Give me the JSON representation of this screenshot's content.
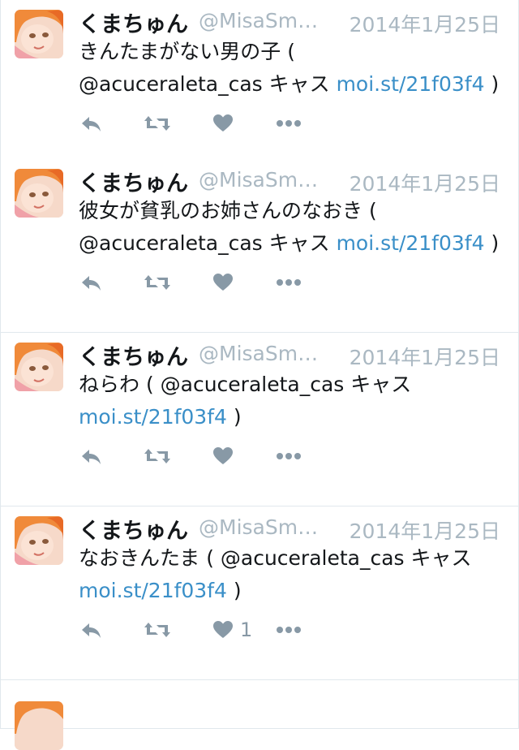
{
  "tweets": [
    {
      "display_name": "くまちゅん",
      "handle": "@MisaSm…",
      "date": "2014年1月25日",
      "text_parts": [
        "きんたまがない男の子 (",
        "@acuceraleta_cas キャス ",
        "moi.st/21f03f4",
        " )"
      ],
      "likes": ""
    },
    {
      "display_name": "くまちゅん",
      "handle": "@MisaSm…",
      "date": "2014年1月25日",
      "text_parts": [
        "彼女が貧乳のお姉さんのなおき (",
        "@acuceraleta_cas キャス ",
        "moi.st/21f03f4",
        " )"
      ],
      "likes": ""
    },
    {
      "display_name": "くまちゅん",
      "handle": "@MisaSm…",
      "date": "2014年1月25日",
      "text_parts": [
        "ねらわ ( @acuceraleta_cas キャス",
        "",
        "moi.st/21f03f4",
        " )"
      ],
      "likes": ""
    },
    {
      "display_name": "くまちゅん",
      "handle": "@MisaSm…",
      "date": "2014年1月25日",
      "text_parts": [
        "なおきんたま ( @acuceraleta_cas キャス",
        "",
        "moi.st/21f03f4",
        " )"
      ],
      "likes": "1"
    }
  ],
  "icons": {
    "reply": "reply-icon",
    "retweet": "retweet-icon",
    "like": "heart-icon",
    "more": "more-icon"
  },
  "colors": {
    "link": "#3a8fc8",
    "meta": "#aab8c2",
    "action": "#8899a6",
    "divider": "#e1e8ed"
  }
}
